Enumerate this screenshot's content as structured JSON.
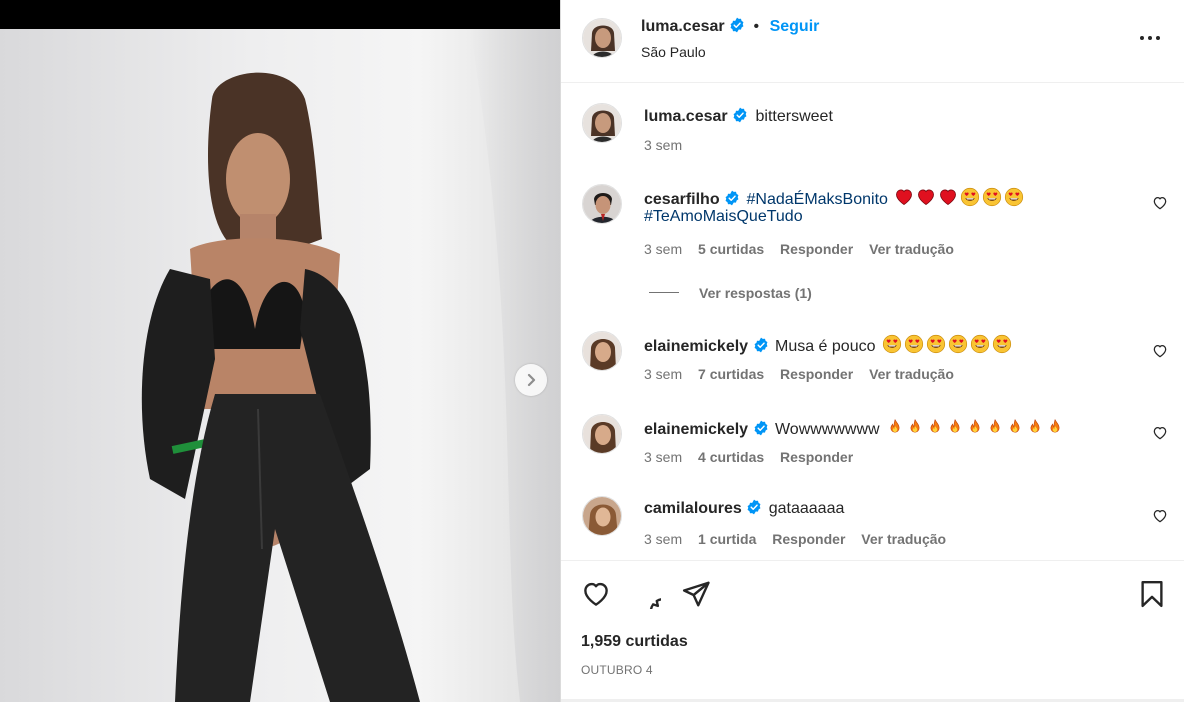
{
  "post": {
    "username": "luma.cesar",
    "follow_label": "Seguir",
    "separator": "•",
    "location": "São Paulo",
    "more_label": "•••"
  },
  "caption": {
    "username": "luma.cesar",
    "text": "bittersweet",
    "time": "3 sem"
  },
  "comments": [
    {
      "username": "cesarfilho",
      "hashtag1": "#NadaÉMaksBonito",
      "hashtag2": "#TeAmoMaisQueTudo",
      "emojis": [
        "heart",
        "heart",
        "heart",
        "heart-eyes",
        "heart-eyes",
        "heart-eyes"
      ],
      "time": "3 sem",
      "likes": "5 curtidas",
      "reply": "Responder",
      "translate": "Ver tradução",
      "view_replies": "Ver respostas (1)"
    },
    {
      "username": "elainemickely",
      "text": "Musa é pouco",
      "emojis": [
        "heart-eyes",
        "heart-eyes",
        "heart-eyes",
        "heart-eyes",
        "heart-eyes",
        "heart-eyes"
      ],
      "time": "3 sem",
      "likes": "7 curtidas",
      "reply": "Responder",
      "translate": "Ver tradução"
    },
    {
      "username": "elainemickely",
      "text": "Wowwwwwww",
      "emojis": [
        "fire",
        "fire",
        "fire",
        "fire",
        "fire",
        "fire",
        "fire",
        "fire",
        "fire"
      ],
      "time": "3 sem",
      "likes": "4 curtidas",
      "reply": "Responder"
    },
    {
      "username": "camilaloures",
      "text": "gataaaaaa",
      "time": "3 sem",
      "likes": "1 curtida",
      "reply": "Responder",
      "translate": "Ver tradução"
    }
  ],
  "footer": {
    "likes": "1,959 curtidas",
    "date": "OUTUBRO 4"
  },
  "colors": {
    "verified": "#0095f6",
    "link": "#0095f6",
    "hashtag": "#00376b",
    "muted": "#737373",
    "heart": "#e0101f",
    "fire": "#f5790e",
    "emoji_face": "#f9c433"
  },
  "icons": [
    "verified-icon",
    "chevron-right-icon",
    "more-icon",
    "heart-outline-icon",
    "comment-icon",
    "share-icon",
    "bookmark-icon",
    "heart-emoji",
    "heart-eyes-emoji",
    "fire-emoji"
  ]
}
